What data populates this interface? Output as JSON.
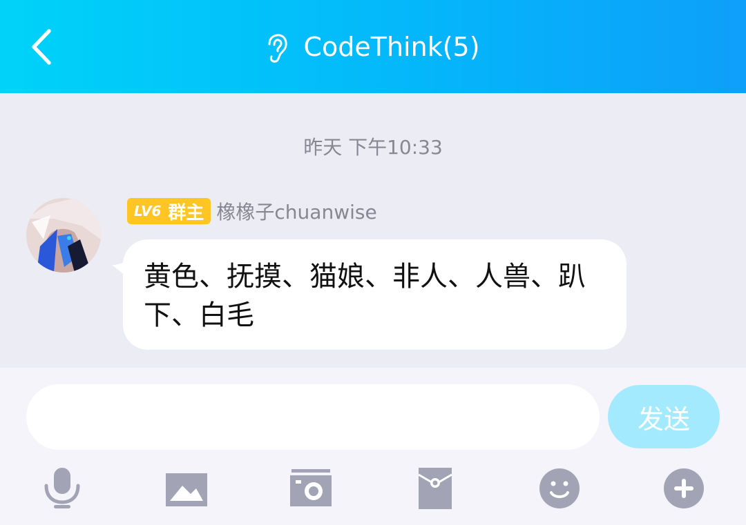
{
  "header": {
    "title": "CodeThink(5)",
    "back_icon": "chevron-left-icon",
    "ear_icon": "ear-icon",
    "gradient_start": "#00d3f9",
    "gradient_end": "#0e9ffa"
  },
  "chat": {
    "timestamp": "昨天 下午10:33",
    "messages": [
      {
        "sender": {
          "level": "LV6",
          "role": "群主",
          "name": "橡橡子chuanwise",
          "badge_color": "#ffc523"
        },
        "text": "黄色、抚摸、猫娘、非人、人兽、趴下、白毛"
      }
    ]
  },
  "composer": {
    "input_value": "",
    "send_label": "发送",
    "send_color": "#a4eafe"
  },
  "toolbar": {
    "icons": [
      "microphone-icon",
      "image-icon",
      "camera-icon",
      "red-packet-icon",
      "emoji-icon",
      "plus-icon"
    ],
    "icon_color": "#a2a3b4"
  }
}
